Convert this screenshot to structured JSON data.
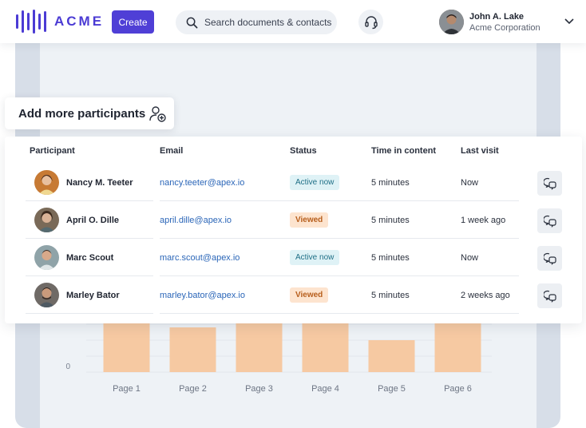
{
  "header": {
    "logo_text": "ACME",
    "create_label": "Create",
    "search_placeholder": "Search documents & contacts",
    "user": {
      "name": "John A. Lake",
      "company": "Acme Corporation"
    }
  },
  "add_participants_label": "Add more participants",
  "table": {
    "columns": [
      "Participant",
      "Email",
      "Status",
      "Time in content",
      "Last visit"
    ],
    "rows": [
      {
        "name": "Nancy M. Teeter",
        "email": "nancy.teeter@apex.io",
        "status": "Active now",
        "status_type": "active",
        "time": "5 minutes",
        "last_visit": "Now",
        "avatar_color": "#c77a34"
      },
      {
        "name": "April O. Dille",
        "email": "april.dille@apex.io",
        "status": "Viewed",
        "status_type": "viewed",
        "time": "5 minutes",
        "last_visit": "1 week ago",
        "avatar_color": "#7a6a58"
      },
      {
        "name": "Marc Scout",
        "email": "marc.scout@apex.io",
        "status": "Active now",
        "status_type": "active",
        "time": "5 minutes",
        "last_visit": "Now",
        "avatar_color": "#8fa3a8"
      },
      {
        "name": "Marley Bator",
        "email": "marley.bator@apex.io",
        "status": "Viewed",
        "status_type": "viewed",
        "time": "5 minutes",
        "last_visit": "2 weeks ago",
        "avatar_color": "#5d4a3e"
      }
    ]
  },
  "chart_data": {
    "type": "bar",
    "categories": [
      "Page 1",
      "Page 2",
      "Page 3",
      "Page 4",
      "Page 5",
      "Page 6"
    ],
    "values": [
      8,
      3.5,
      8,
      8,
      2.5,
      8
    ],
    "ylim": [
      0,
      10
    ],
    "y_tick_labels": [
      "0"
    ],
    "bar_color": "#f6c9a2",
    "grid": true
  },
  "colors": {
    "brand": "#4b3bd4",
    "link": "#2b66b8",
    "active_bg": "#dff2f6",
    "viewed_bg": "#fde4cf"
  },
  "icons": {
    "search": "search-icon",
    "support": "headset-icon",
    "add": "add-user-icon",
    "chat": "chat-icon",
    "chevron": "chevron-down-icon"
  }
}
